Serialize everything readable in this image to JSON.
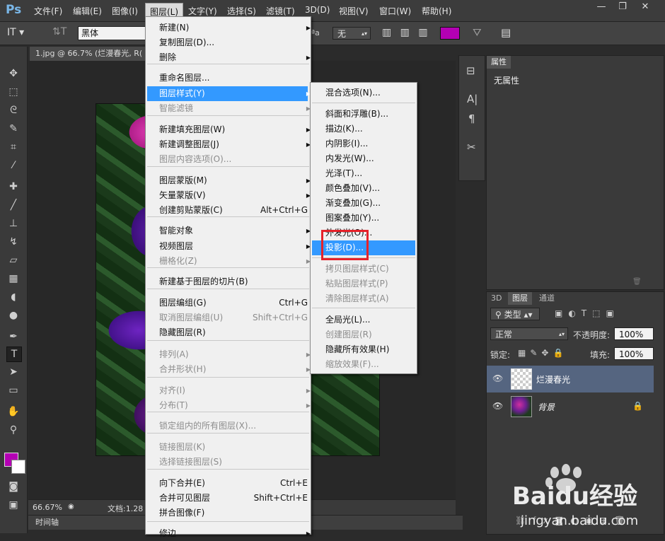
{
  "app": {
    "logo": "Ps"
  },
  "menubar": {
    "items": [
      "文件(F)",
      "编辑(E)",
      "图像(I)",
      "图层(L)",
      "文字(Y)",
      "选择(S)",
      "滤镜(T)",
      "3D(D)",
      "视图(V)",
      "窗口(W)",
      "帮助(H)"
    ],
    "active": "图层(L)"
  },
  "window_controls": {
    "minimize": "—",
    "restore": "❐",
    "close": "✕"
  },
  "options": {
    "font_family": "黑体",
    "aa_label": "ªa",
    "aa_value": "无"
  },
  "colors": {
    "foreground": "#b400b4",
    "background": "#ffffff",
    "highlight": "#3399ff",
    "annotation": "#e6222a"
  },
  "document": {
    "tab_title": "1.jpg @ 66.7% (烂漫春光, R(",
    "zoom": "66.67%",
    "doc_info": "文档:1.28",
    "timeline": "时间轴"
  },
  "layer_menu": {
    "items": [
      {
        "label": "新建(N)",
        "sub": true
      },
      {
        "label": "复制图层(D)..."
      },
      {
        "label": "删除",
        "sub": true
      },
      {
        "label": "重命名图层..."
      },
      {
        "label": "图层样式(Y)",
        "sub": true,
        "highlight": true
      },
      {
        "label": "智能滤镜",
        "sub": true,
        "disabled": true
      },
      {
        "label": "新建填充图层(W)",
        "sub": true
      },
      {
        "label": "新建调整图层(J)",
        "sub": true
      },
      {
        "label": "图层内容选项(O)...",
        "disabled": true
      },
      {
        "label": "图层蒙版(M)",
        "sub": true
      },
      {
        "label": "矢量蒙版(V)",
        "sub": true
      },
      {
        "label": "创建剪贴蒙版(C)",
        "shortcut": "Alt+Ctrl+G"
      },
      {
        "label": "智能对象",
        "sub": true
      },
      {
        "label": "视频图层",
        "sub": true
      },
      {
        "label": "栅格化(Z)",
        "sub": true,
        "disabled": true
      },
      {
        "label": "新建基于图层的切片(B)"
      },
      {
        "label": "图层编组(G)",
        "shortcut": "Ctrl+G"
      },
      {
        "label": "取消图层编组(U)",
        "shortcut": "Shift+Ctrl+G",
        "disabled": true
      },
      {
        "label": "隐藏图层(R)"
      },
      {
        "label": "排列(A)",
        "sub": true,
        "disabled": true
      },
      {
        "label": "合并形状(H)",
        "sub": true,
        "disabled": true
      },
      {
        "label": "对齐(I)",
        "sub": true,
        "disabled": true
      },
      {
        "label": "分布(T)",
        "sub": true,
        "disabled": true
      },
      {
        "label": "锁定组内的所有图层(X)...",
        "disabled": true
      },
      {
        "label": "链接图层(K)",
        "disabled": true
      },
      {
        "label": "选择链接图层(S)",
        "disabled": true
      },
      {
        "label": "向下合并(E)",
        "shortcut": "Ctrl+E"
      },
      {
        "label": "合并可见图层",
        "shortcut": "Shift+Ctrl+E"
      },
      {
        "label": "拼合图像(F)"
      },
      {
        "label": "修边",
        "sub": true
      }
    ]
  },
  "style_menu": {
    "items": [
      {
        "label": "混合选项(N)..."
      },
      {
        "label": "斜面和浮雕(B)..."
      },
      {
        "label": "描边(K)..."
      },
      {
        "label": "内阴影(I)..."
      },
      {
        "label": "内发光(W)..."
      },
      {
        "label": "光泽(T)..."
      },
      {
        "label": "颜色叠加(V)..."
      },
      {
        "label": "渐变叠加(G)..."
      },
      {
        "label": "图案叠加(Y)..."
      },
      {
        "label": "外发光(O)..."
      },
      {
        "label": "投影(D)...",
        "highlight": true
      },
      {
        "label": "拷贝图层样式(C)",
        "disabled": true
      },
      {
        "label": "粘贴图层样式(P)",
        "disabled": true
      },
      {
        "label": "清除图层样式(A)",
        "disabled": true
      },
      {
        "label": "全局光(L)..."
      },
      {
        "label": "创建图层(R)",
        "disabled": true
      },
      {
        "label": "隐藏所有效果(H)"
      },
      {
        "label": "缩放效果(F)...",
        "disabled": true
      }
    ]
  },
  "properties": {
    "tab": "属性",
    "content": "无属性"
  },
  "layers": {
    "tabs": [
      "3D",
      "图层",
      "通道"
    ],
    "active_tab": "图层",
    "filter_kind": "类型",
    "blend_mode": "正常",
    "opacity_label": "不透明度:",
    "opacity_value": "100%",
    "lock_label": "锁定:",
    "fill_label": "填充:",
    "fill_value": "100%",
    "items": [
      {
        "name": "烂漫春光",
        "selected": true
      },
      {
        "name": "背景",
        "locked": true
      }
    ]
  },
  "watermark": {
    "brand": "Baidu经验",
    "url": "jingyan.baidu.com"
  }
}
